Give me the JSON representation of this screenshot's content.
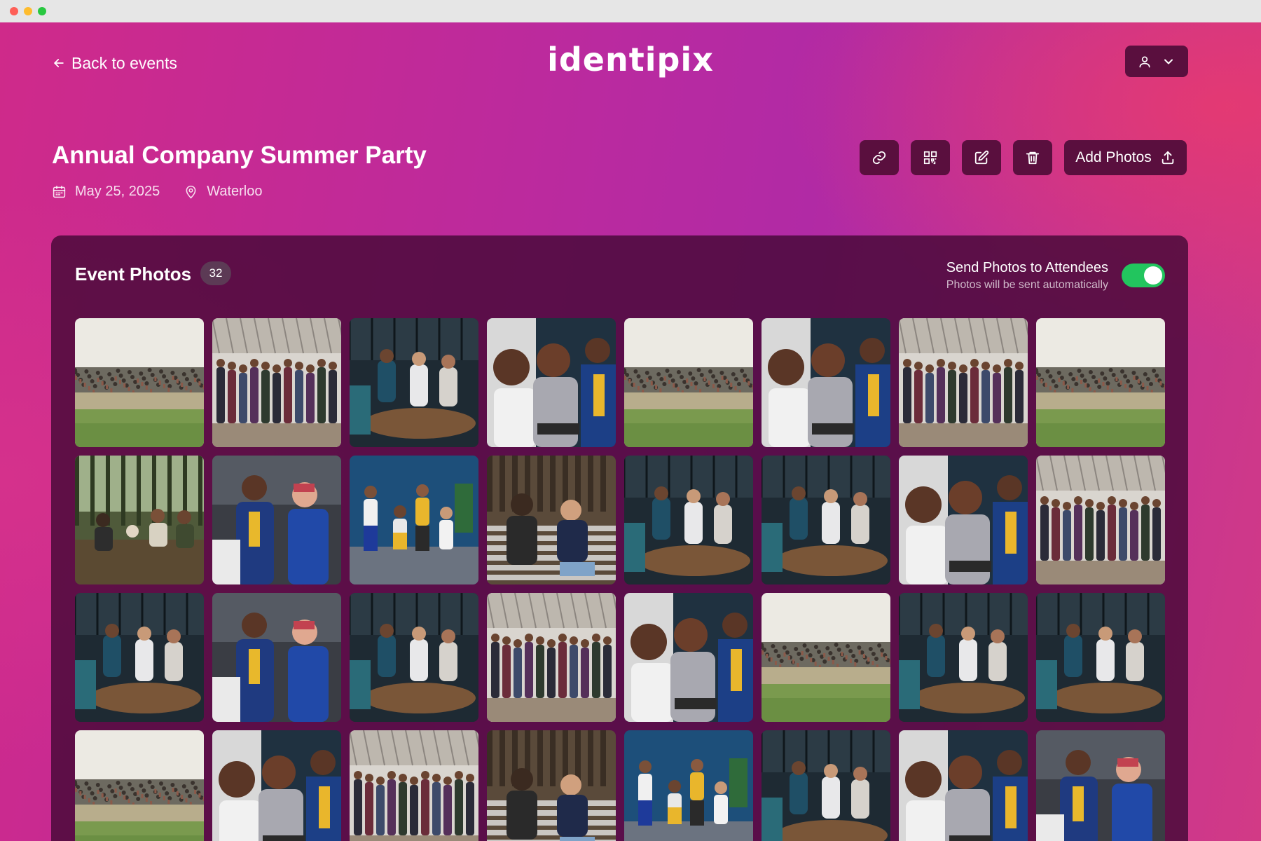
{
  "header": {
    "back_label": "Back to events",
    "logo_text": "identipix"
  },
  "event": {
    "title": "Annual Company Summer Party",
    "date": "May 25, 2025",
    "location": "Waterloo"
  },
  "actions": {
    "add_photos_label": "Add Photos"
  },
  "photos_panel": {
    "title": "Event Photos",
    "count": "32",
    "send_title": "Send Photos to Attendees",
    "send_subtitle": "Photos will be sent automatically",
    "send_enabled": true
  },
  "photos": [
    "crowd-field",
    "office-group",
    "lounge-table",
    "laptop-trio",
    "crowd-field",
    "laptop-trio",
    "office-group",
    "crowd-field",
    "park-picnic",
    "tablet-pair",
    "blue-wall-group",
    "stairs-pair",
    "lounge-table",
    "lounge-table",
    "laptop-trio",
    "office-group",
    "lounge-table",
    "tablet-pair",
    "lounge-table",
    "office-group",
    "laptop-trio",
    "crowd-field",
    "lounge-table",
    "lounge-table",
    "crowd-field",
    "laptop-trio",
    "office-group",
    "stairs-pair",
    "blue-wall-group",
    "lounge-table",
    "laptop-trio",
    "tablet-pair"
  ],
  "colors": {
    "button_bg": "#5a0f3e",
    "panel_bg": "#46083a",
    "toggle_on": "#22c55e"
  }
}
